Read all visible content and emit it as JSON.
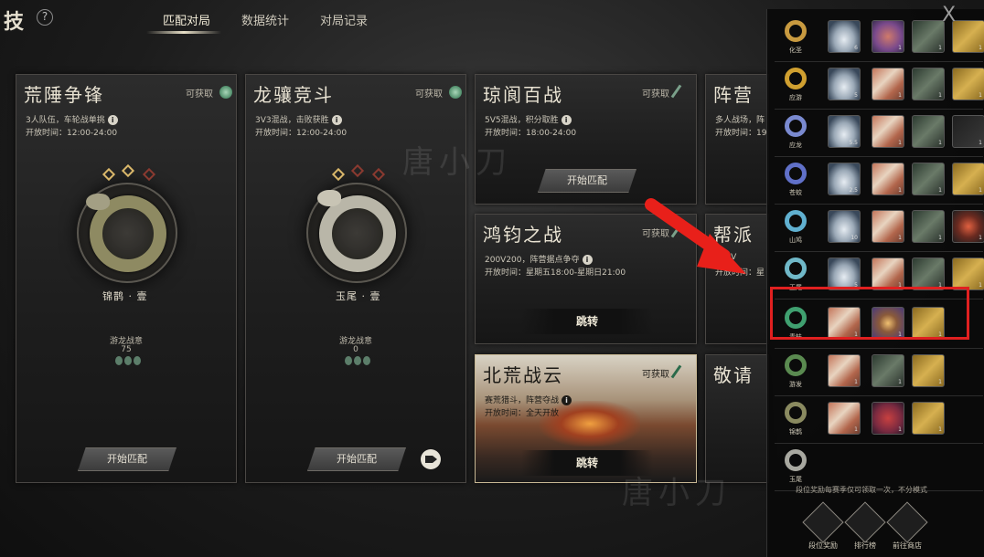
{
  "header": {
    "title": "技",
    "help": "?",
    "tabs": [
      "匹配对局",
      "数据统计",
      "对局记录"
    ]
  },
  "cards": {
    "huangye": {
      "title": "荒陲争锋",
      "badge": "可获取",
      "line1": "3人队伍，车轮战单挑",
      "line2": "开放时间：12:00-24:00",
      "rank_name": "锦鹊 · 壹",
      "points_label": "游龙战意",
      "points": "75",
      "button": "开始匹配"
    },
    "longxiang": {
      "title": "龙骧竞斗",
      "badge": "可获取",
      "line1": "3V3混战，击败获胜",
      "line2": "开放时间：12:00-24:00",
      "rank_name": "玉尾 · 壹",
      "points_label": "游龙战意",
      "points": "0",
      "button": "开始匹配"
    },
    "qiongwen": {
      "title": "琼阆百战",
      "badge": "可获取",
      "line1": "5V5混战，积分取胜",
      "line2": "开放时间：18:00-24:00",
      "button": "开始匹配"
    },
    "zhenying": {
      "title": "阵营",
      "line1": "多人战场，阵",
      "line2": "开放时间：19"
    },
    "hongjun": {
      "title": "鸿钧之战",
      "badge": "可获取",
      "line1": "200V200，阵营据点争夺",
      "line2": "开放时间：星期五18:00-星期日21:00",
      "button": "跳转"
    },
    "bangpai": {
      "title": "帮派",
      "line1": "200V",
      "line2": "开放时间：星"
    },
    "beihuang": {
      "title": "北荒战云",
      "badge": "可获取",
      "line1": "赛荒猎斗，阵营夺战",
      "line2": "开放时间：全天开放",
      "button": "跳转"
    },
    "jingqing": {
      "title": "敬请"
    }
  },
  "watermark": "唐小刀",
  "panel": {
    "note": "段位奖励每赛季仅可领取一次，不分模式",
    "rows": [
      {
        "rank": "化圣",
        "ring": "#c89a40",
        "items": [
          [
            "silver",
            "6"
          ],
          [
            "pill",
            "1"
          ],
          [
            "jade",
            "1"
          ],
          [
            "gold",
            "1"
          ]
        ]
      },
      {
        "rank": "应游",
        "ring": "#d0a030",
        "items": [
          [
            "silver",
            "5"
          ],
          [
            "book",
            "1"
          ],
          [
            "jade",
            "1"
          ],
          [
            "gold",
            "1"
          ]
        ]
      },
      {
        "rank": "应龙",
        "ring": "#7a8ad0",
        "items": [
          [
            "silver",
            "5.5"
          ],
          [
            "book",
            "1"
          ],
          [
            "jade",
            "1"
          ],
          [
            "dark",
            "1"
          ]
        ]
      },
      {
        "rank": "苍蛟",
        "ring": "#6070c8",
        "items": [
          [
            "silver",
            "2.5"
          ],
          [
            "book",
            "1"
          ],
          [
            "jade",
            "1"
          ],
          [
            "gold",
            "1"
          ]
        ]
      },
      {
        "rank": "山鸠",
        "ring": "#60b0d0",
        "items": [
          [
            "silver",
            "10"
          ],
          [
            "book",
            "1"
          ],
          [
            "jade",
            "1"
          ],
          [
            "fire",
            "1"
          ]
        ]
      },
      {
        "rank": "玉尾",
        "ring": "#70b8c8",
        "items": [
          [
            "silver",
            "5"
          ],
          [
            "book",
            "1"
          ],
          [
            "jade",
            "1"
          ],
          [
            "gold",
            "1"
          ]
        ]
      },
      {
        "rank": "青蚨",
        "ring": "#40a070",
        "items": [
          [
            "book",
            "1"
          ],
          [
            "egg",
            "1"
          ],
          [
            "gold",
            "1"
          ]
        ]
      },
      {
        "rank": "游发",
        "ring": "#5a8a50",
        "items": [
          [
            "book",
            "1"
          ],
          [
            "jade",
            "1"
          ],
          [
            "gold",
            "1"
          ]
        ]
      },
      {
        "rank": "锦鹊",
        "ring": "#8a8a60",
        "items": [
          [
            "book",
            "1"
          ],
          [
            "bag",
            "1"
          ],
          [
            "gold",
            "1"
          ]
        ]
      },
      {
        "rank": "玉尾",
        "ring": "#a8a8a0",
        "items": []
      }
    ],
    "buttons": [
      "段位奖励",
      "排行榜",
      "前往商店"
    ],
    "close": "X"
  }
}
